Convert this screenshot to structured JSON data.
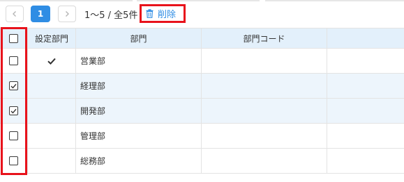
{
  "pager": {
    "current_page": "1",
    "range_text": "1～5 / 全5件",
    "delete_label": "削除"
  },
  "table": {
    "headers": [
      "",
      "設定部門",
      "部門",
      "部門コード"
    ],
    "rows": [
      {
        "checked": false,
        "setting": true,
        "dept": "営業部",
        "code": ""
      },
      {
        "checked": true,
        "setting": false,
        "dept": "経理部",
        "code": ""
      },
      {
        "checked": true,
        "setting": false,
        "dept": "開発部",
        "code": ""
      },
      {
        "checked": false,
        "setting": false,
        "dept": "管理部",
        "code": ""
      },
      {
        "checked": false,
        "setting": false,
        "dept": "総務部",
        "code": ""
      }
    ]
  },
  "colors": {
    "accent": "#2f8de4",
    "highlight": "#e8121b",
    "header_bg": "#e3f0fb",
    "alt_row_bg": "#edf5fc"
  },
  "icons": [
    "chevron-left-icon",
    "chevron-right-icon",
    "trash-icon",
    "checkmark-icon"
  ]
}
